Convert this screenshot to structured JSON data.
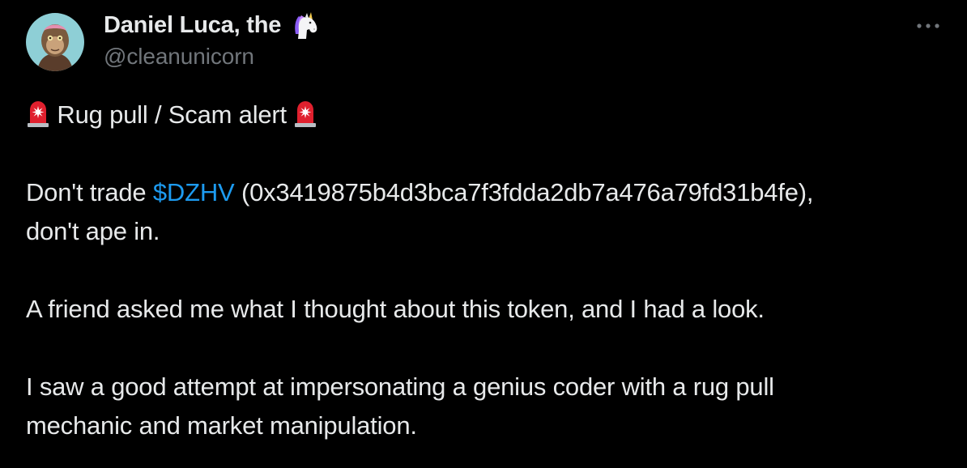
{
  "author": {
    "display_name": "Daniel Luca, the",
    "handle": "@cleanunicorn",
    "badge_icon": "unicorn-icon",
    "avatar_bg": "#8ecfd6"
  },
  "more_button_icon": "ellipsis-icon",
  "body": {
    "line1_text": "Rug pull / Scam alert",
    "line1_icon": "siren-icon",
    "para2_before": "Don't trade ",
    "cashtag": "$DZHV",
    "para2_after": " (0x3419875b4d3bca7f3fdda2db7a476a79fd31b4fe),",
    "para2_line2": "don't ape in.",
    "para3": "A friend asked me what I thought about this token, and I had a look.",
    "para4_line1": "I saw a good attempt at impersonating a genius coder with a rug pull",
    "para4_line2": "mechanic and market manipulation."
  },
  "colors": {
    "background": "#000000",
    "text": "#e7e9ea",
    "secondary_text": "#71767b",
    "link": "#1d9bf0",
    "siren_red": "#e0202e"
  }
}
